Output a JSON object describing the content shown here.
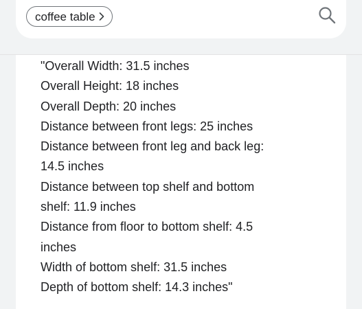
{
  "search": {
    "chip_label": "coffee table",
    "chip_icon": "chevron-right-icon",
    "search_icon": "search-icon"
  },
  "content": {
    "lines": [
      "\"Overall Width: 31.5 inches",
      "Overall Height: 18 inches",
      "Overall Depth: 20 inches",
      "Distance between front legs: 25 inches",
      "Distance between front leg and back leg:",
      "14.5 inches",
      "Distance between top shelf and bottom",
      "shelf: 11.9 inches",
      "Distance from floor to bottom shelf: 4.5",
      "inches",
      "Width of bottom shelf: 31.5 inches",
      "Depth of bottom shelf: 14.3 inches\""
    ]
  },
  "colors": {
    "background": "#f1f3f4",
    "card": "#ffffff",
    "text": "#202124",
    "icon": "#70757a"
  }
}
